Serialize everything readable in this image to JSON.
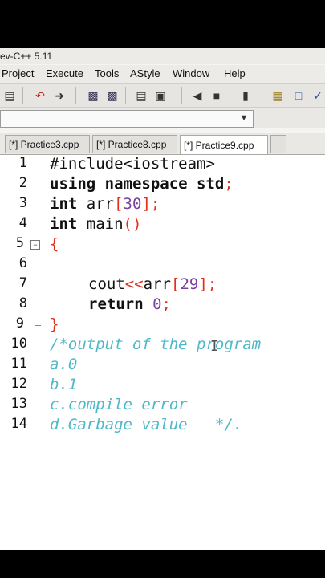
{
  "window": {
    "title": "ev-C++ 5.11"
  },
  "menu": [
    "Project",
    "Execute",
    "Tools",
    "AStyle",
    "Window",
    "Help"
  ],
  "toolbar": {
    "icons": [
      "print-icon",
      "undo-icon",
      "redo-icon",
      "find-icon",
      "replace-icon",
      "indent-icon",
      "unindent-icon",
      "bookmark-icon",
      "goto-icon",
      "compile-icon",
      "grid-icon",
      "chart-icon",
      "check-icon"
    ]
  },
  "tabs": [
    "[*] Practice3.cpp",
    "[*] Practice8.cpp",
    "[*] Practice9.cpp"
  ],
  "code": {
    "line_numbers": [
      "1",
      "2",
      "3",
      "4",
      "5",
      "6",
      "7",
      "8",
      "9",
      "10",
      "11",
      "12",
      "13",
      "14"
    ],
    "l1": "#include<iostream>",
    "l2_kw": "using namespace",
    "l2_rest": " std",
    "l2_semi": ";",
    "l3_kw": "int",
    "l3_rest": " arr",
    "l3_open": "[",
    "l3_num": "30",
    "l3_close": "];",
    "l4_kw": "int",
    "l4_rest": " main",
    "l4_paren": "()",
    "l5_brace": "{",
    "l7_a": "cout",
    "l7_op": "<<",
    "l7_b": "arr",
    "l7_open": "[",
    "l7_num": "29",
    "l7_close": "];",
    "l8_kw": "return",
    "l8_num": "0",
    "l8_semi": ";",
    "l9_brace": "}",
    "l10": "/*output of the program",
    "l11": "a.0",
    "l12": "b.1",
    "l13": "c.compile error",
    "l14": "d.Garbage value   */."
  },
  "colors": {
    "operator": "#e0301e",
    "number": "#7b3fa0",
    "comment": "#4fb8c8"
  }
}
